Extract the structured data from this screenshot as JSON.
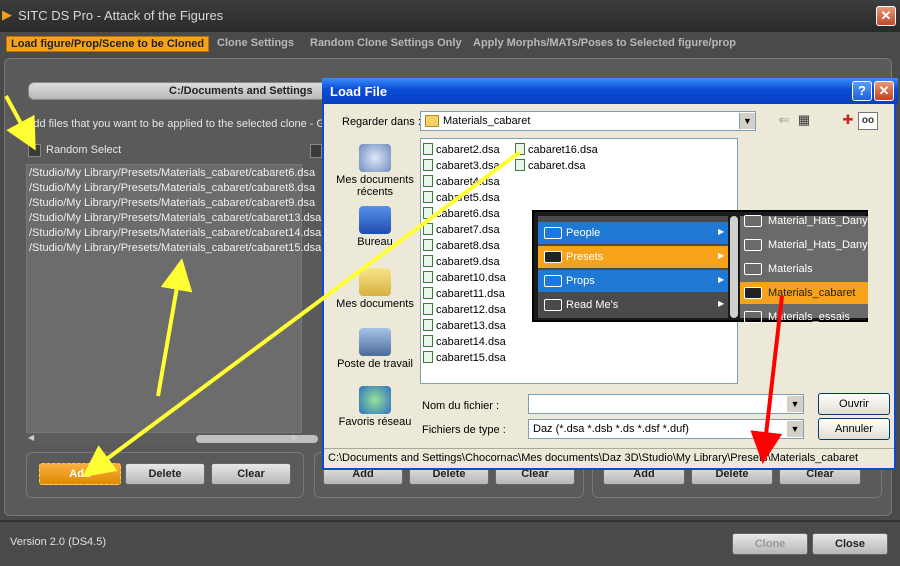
{
  "window": {
    "title": "SITC DS Pro - Attack of the Figures"
  },
  "tabs": [
    {
      "label": "Load figure/Prop/Scene to be Cloned"
    },
    {
      "label": "Clone Settings"
    },
    {
      "label": "Random Clone Settings Only"
    },
    {
      "label": "Apply Morphs/MATs/Poses to Selected figure/prop"
    }
  ],
  "main": {
    "path_button": "C:/Documents and Settings",
    "hint": "Add files that you want to be applied to the selected clone - Gene",
    "random_select_label": "Random Select",
    "files": [
      "/Studio/My Library/Presets/Materials_cabaret/cabaret6.dsa",
      "/Studio/My Library/Presets/Materials_cabaret/cabaret8.dsa",
      "/Studio/My Library/Presets/Materials_cabaret/cabaret9.dsa",
      "/Studio/My Library/Presets/Materials_cabaret/cabaret13.dsa",
      "/Studio/My Library/Presets/Materials_cabaret/cabaret14.dsa",
      "/Studio/My Library/Presets/Materials_cabaret/cabaret15.dsa"
    ],
    "buttons": {
      "add": "Add",
      "delete": "Delete",
      "clear": "Clear"
    }
  },
  "footer": {
    "version": "Version 2.0 (DS4.5)",
    "clone": "Clone",
    "close": "Close"
  },
  "dialog": {
    "title": "Load File",
    "lookin_label": "Regarder dans :",
    "lookin_value": "Materials_cabaret",
    "places": [
      "Mes documents récents",
      "Bureau",
      "Mes documents",
      "Poste de travail",
      "Favoris réseau"
    ],
    "files_col1": [
      "cabaret2.dsa",
      "cabaret3.dsa",
      "cabaret4.dsa",
      "cabaret5.dsa",
      "cabaret6.dsa",
      "cabaret7.dsa",
      "cabaret8.dsa",
      "cabaret9.dsa",
      "cabaret10.dsa",
      "cabaret11.dsa",
      "cabaret12.dsa",
      "cabaret13.dsa",
      "cabaret14.dsa",
      "cabaret15.dsa"
    ],
    "files_col2": [
      "cabaret16.dsa",
      "cabaret.dsa"
    ],
    "filename_label": "Nom du fichier :",
    "filetype_label": "Fichiers de type :",
    "filetype_value": "Daz (*.dsa *.dsb *.ds *.dsf *.duf)",
    "open": "Ouvrir",
    "cancel": "Annuler",
    "status_path": "C:\\Documents and Settings\\Chocornac\\Mes documents\\Daz 3D\\Studio\\My Library\\Presets\\Materials_cabaret"
  },
  "menu_inset": {
    "left_items": [
      {
        "label": "People",
        "color": "#1f78d4"
      },
      {
        "label": "Presets",
        "color": "#f7a21b"
      },
      {
        "label": "Props",
        "color": "#1f78d4"
      },
      {
        "label": "Read Me's",
        "color": "#4a4a4a"
      }
    ],
    "right_items": [
      "Material_Hats_Dany",
      "Material_Hats_Dany",
      "Materials",
      "Materials_cabaret",
      "Materials_essais"
    ]
  },
  "colors": {
    "accent": "#f7a21b",
    "annotation_yellow": "#ffff33",
    "annotation_red": "#ff0000",
    "xp_blue": "#0a4bd6"
  }
}
